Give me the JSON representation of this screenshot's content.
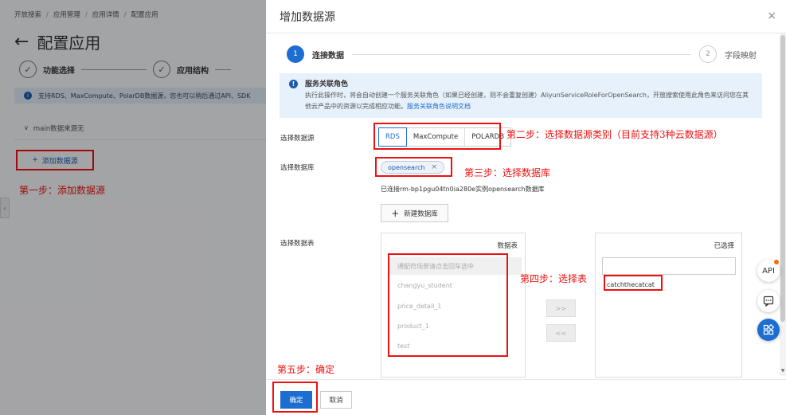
{
  "background": {
    "breadcrumb": [
      "开放搜索",
      "应用管理",
      "应用详情",
      "配置应用"
    ],
    "title": "配置应用",
    "steps": [
      {
        "num": "✓",
        "label": "功能选择"
      },
      {
        "num": "✓",
        "label": "应用结构"
      }
    ],
    "info_text": "支持RDS、MaxCompute、PolarDB数据源，您也可以稍后通过API、SDK",
    "ds_section": "main数据来源无",
    "add_datasource": "添加数据源"
  },
  "drawer": {
    "title": "增加数据源",
    "wizard": [
      {
        "num": "1",
        "label": "连接数据"
      },
      {
        "num": "2",
        "label": "字段映射"
      }
    ],
    "notice": {
      "title": "服务关联角色",
      "body": "执行此操作时，将会自动创建一个服务关联角色（如果已经创建，则不会重复创建）AliyunServiceRoleForOpenSearch，开放搜索使用此角色来访问您在其他云产品中的资源以完成相应功能。",
      "link": "服务关联角色说明文档"
    },
    "datasource_label": "选择数据源",
    "datasource_options": [
      "RDS",
      "MaxCompute",
      "POLARDB"
    ],
    "database_label": "选择数据库",
    "database_tag": "opensearch",
    "connected_text": "已连接rm-bp1pgu04tn0ia280e实例opensearch数据库",
    "new_database": "新建数据库",
    "table_label": "选择数据表",
    "left_panel_title": "数据表",
    "tables": [
      "通配符场景请点击回车选中",
      "changyu_student",
      "price_detail_1",
      "product_1",
      "test"
    ],
    "right_panel_title": "已选择",
    "selected_tables": [
      "catchthecatcat"
    ],
    "move_right": ">>",
    "move_left": "<<",
    "ok": "确定",
    "cancel": "取消"
  },
  "annotations": {
    "step1": "第一步：添加数据源",
    "step2": "第二步：选择数据源类别（目前支持3种云数据源）",
    "step3": "第三步：选择数据库",
    "step4": "第四步：选择表",
    "step5": "第五步：确定"
  },
  "float_tools": {
    "api": "API"
  },
  "colors": {
    "primary": "#1d6ed0",
    "annotation": "#e11111"
  }
}
